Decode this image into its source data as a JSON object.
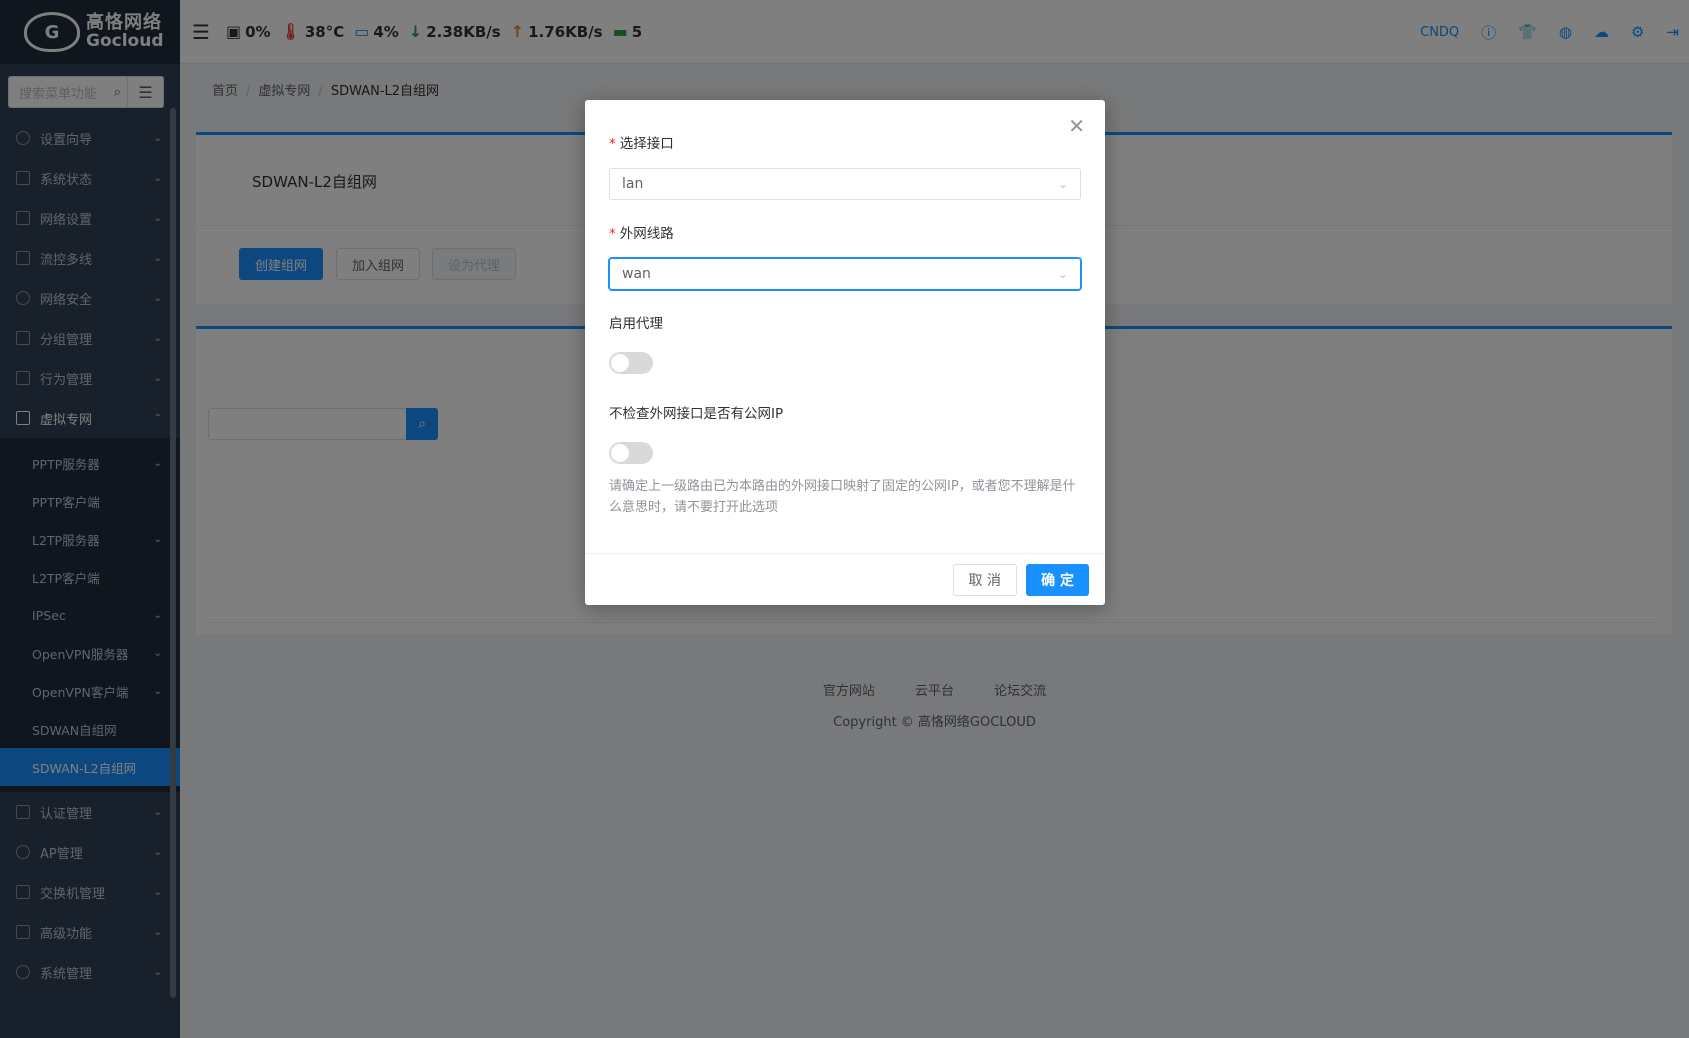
{
  "sidebar": {
    "logo_cn": "高恪网络",
    "logo_en": "Gocloud",
    "search_placeholder": "搜索菜单功能",
    "menu": [
      {
        "label": "设置向导"
      },
      {
        "label": "系统状态"
      },
      {
        "label": "网络设置"
      },
      {
        "label": "流控多线"
      },
      {
        "label": "网络安全"
      },
      {
        "label": "分组管理"
      },
      {
        "label": "行为管理"
      },
      {
        "label": "虚拟专网"
      }
    ],
    "submenu": [
      {
        "label": "PPTP服务器"
      },
      {
        "label": "PPTP客户端"
      },
      {
        "label": "L2TP服务器"
      },
      {
        "label": "L2TP客户端"
      },
      {
        "label": "IPSec"
      },
      {
        "label": "OpenVPN服务器"
      },
      {
        "label": "OpenVPN客户端"
      },
      {
        "label": "SDWAN自组网"
      },
      {
        "label": "SDWAN-L2自组网"
      }
    ],
    "menu_after": [
      {
        "label": "认证管理"
      },
      {
        "label": "AP管理"
      },
      {
        "label": "交换机管理"
      },
      {
        "label": "高级功能"
      },
      {
        "label": "系统管理"
      }
    ]
  },
  "header": {
    "cpu": "0%",
    "temp": "38°C",
    "mem": "4%",
    "down": "2.38KB/s",
    "up": "1.76KB/s",
    "devices": "5",
    "user": "CNDQ"
  },
  "breadcrumb": {
    "home": "首页",
    "parent": "虚拟专网",
    "current": "SDWAN-L2自组网"
  },
  "card": {
    "title": "SDWAN-L2自组网",
    "btn_create": "创建组网",
    "btn_join": "加入组网",
    "btn_proxy": "设为代理"
  },
  "footer": {
    "link1": "官方网站",
    "link2": "云平台",
    "link3": "论坛交流",
    "copyright": "Copyright © 高恪网络GOCLOUD"
  },
  "modal": {
    "interface_label": "选择接口",
    "interface_value": "lan",
    "wan_label": "外网线路",
    "wan_value": "wan",
    "proxy_label": "启用代理",
    "proxy_enabled": false,
    "nocheck_label": "不检查外网接口是否有公网IP",
    "nocheck_enabled": false,
    "hint": "请确定上一级路由已为本路由的外网接口映射了固定的公网IP，或者您不理解是什么意思时，请不要打开此选项",
    "cancel": "取 消",
    "ok": "确 定"
  }
}
